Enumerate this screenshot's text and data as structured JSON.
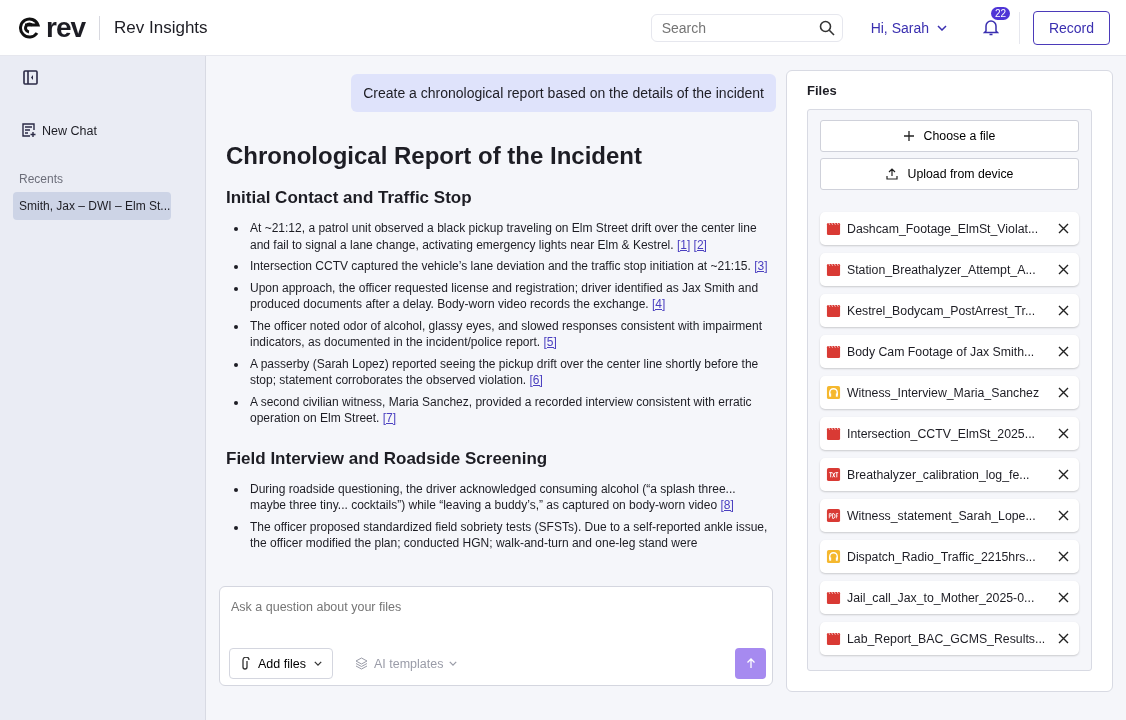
{
  "header": {
    "brand": "rev",
    "product": "Rev Insights",
    "search": {
      "placeholder": "Search"
    },
    "greeting": "Hi, Sarah",
    "notifications": "22",
    "record_button": "Record"
  },
  "sidebar": {
    "new_chat": "New Chat",
    "recents_label": "Recents",
    "items": [
      {
        "label": "Smith, Jax – DWI – Elm St...",
        "selected": true
      }
    ]
  },
  "chat": {
    "user_message": "Create a chronological report based on the details of the incident",
    "title": "Chronological Report of the Incident",
    "sections": [
      {
        "heading": "Initial Contact and Traffic Stop",
        "bullets": [
          {
            "text": "At ~21:12, a patrol unit observed a black pickup traveling on Elm Street drift over the center line and fail to signal a lane change, activating emergency lights near Elm & Kestrel.",
            "citations": [
              "[1]",
              "[2]"
            ]
          },
          {
            "text": "Intersection CCTV captured the vehicle’s lane deviation and the traffic stop initiation at ~21:15.",
            "citations": [
              "[3]"
            ]
          },
          {
            "text": "Upon approach, the officer requested license and registration; driver identified as Jax Smith and produced documents after a delay. Body-worn video records the exchange.",
            "citations": [
              "[4]"
            ]
          },
          {
            "text": "The officer noted odor of alcohol, glassy eyes, and slowed responses consistent with impairment indicators, as documented in the incident/police report.",
            "citations": [
              "[5]"
            ]
          },
          {
            "text": "A passerby (Sarah Lopez) reported seeing the pickup drift over the center line shortly before the stop; statement corroborates the observed violation.",
            "citations": [
              "[6]"
            ]
          },
          {
            "text": "A second civilian witness, Maria Sanchez, provided a recorded interview consistent with erratic operation on Elm Street.",
            "citations": [
              "[7]"
            ]
          }
        ]
      },
      {
        "heading": "Field Interview and Roadside Screening",
        "bullets": [
          {
            "text": "During roadside questioning, the driver acknowledged consuming alcohol (“a splash three... maybe three tiny... cocktails”) while “leaving a buddy’s,” as captured on body-worn video",
            "citations": [
              "[8]"
            ]
          },
          {
            "text": "The officer proposed standardized field sobriety tests (SFSTs). Due to a self-reported ankle issue, the officer modified the plan; conducted HGN; walk-and-turn and one-leg stand were"
          }
        ]
      }
    ]
  },
  "composer": {
    "placeholder": "Ask a question about your files",
    "add_files": "Add files",
    "templates": "AI templates"
  },
  "files": {
    "title": "Files",
    "choose": "Choose a file",
    "upload": "Upload from device",
    "items": [
      {
        "name": "Dashcam_Footage_ElmSt_Violat...",
        "kind": "video"
      },
      {
        "name": "Station_Breathalyzer_Attempt_A...",
        "kind": "video"
      },
      {
        "name": "Kestrel_Bodycam_PostArrest_Tr...",
        "kind": "video"
      },
      {
        "name": "Body Cam Footage of Jax Smith...",
        "kind": "video"
      },
      {
        "name": "Witness_Interview_Maria_Sanchez",
        "kind": "audio"
      },
      {
        "name": "Intersection_CCTV_ElmSt_2025...",
        "kind": "video"
      },
      {
        "name": "Breathalyzer_calibration_log_fe...",
        "kind": "text"
      },
      {
        "name": "Witness_statement_Sarah_Lope...",
        "kind": "pdf"
      },
      {
        "name": "Dispatch_Radio_Traffic_2215hrs...",
        "kind": "audio"
      },
      {
        "name": "Jail_call_Jax_to_Mother_2025-0...",
        "kind": "video"
      },
      {
        "name": "Lab_Report_BAC_GCMS_Results...",
        "kind": "video"
      }
    ]
  }
}
